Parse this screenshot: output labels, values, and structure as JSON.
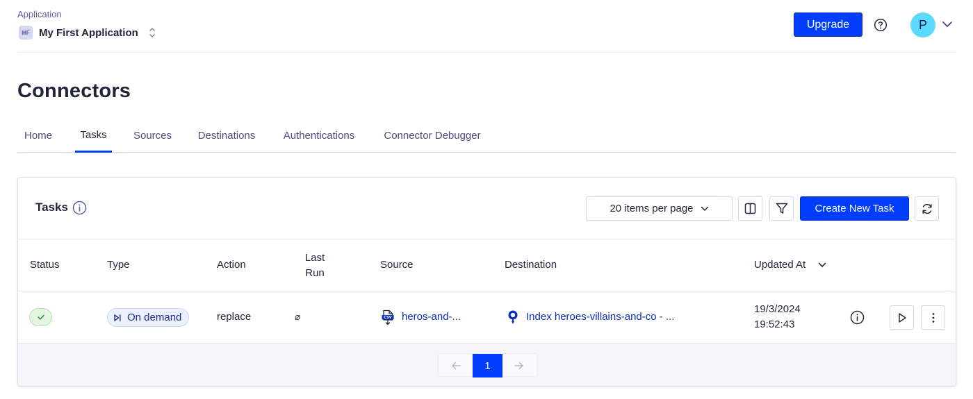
{
  "app": {
    "label": "Application",
    "avatar_initials": "MF",
    "name": "My First Application"
  },
  "header": {
    "upgrade_label": "Upgrade",
    "user_initial": "P"
  },
  "page": {
    "title": "Connectors"
  },
  "tabs": [
    {
      "label": "Home",
      "active": false
    },
    {
      "label": "Tasks",
      "active": true
    },
    {
      "label": "Sources",
      "active": false
    },
    {
      "label": "Destinations",
      "active": false
    },
    {
      "label": "Authentications",
      "active": false
    },
    {
      "label": "Connector Debugger",
      "active": false
    }
  ],
  "panel": {
    "title": "Tasks",
    "per_page_label": "20 items per page",
    "create_label": "Create New Task"
  },
  "table": {
    "columns": {
      "status": "Status",
      "type": "Type",
      "action": "Action",
      "last_run_1": "Last",
      "last_run_2": "Run",
      "source": "Source",
      "destination": "Destination",
      "updated_at": "Updated At"
    },
    "rows": [
      {
        "status": "success",
        "type": "On demand",
        "action": "replace",
        "last_run": "⌀",
        "source": "heros-and-...",
        "destination": "Index heroes-villains-and-co - ...",
        "updated_date": "19/3/2024",
        "updated_time": "19:52:43"
      }
    ]
  },
  "pagination": {
    "current_page": "1"
  },
  "colors": {
    "primary": "#003dff",
    "text": "#23263b",
    "success_bg": "#e3f6e2",
    "success_fg": "#2e8b2a"
  },
  "icons": {
    "help": "help-circle-icon",
    "user_menu": "chevron-down-icon",
    "columns": "columns-icon",
    "filter": "filter-icon",
    "refresh": "refresh-icon",
    "info": "info-icon",
    "play": "play-icon",
    "more": "more-vertical-icon"
  }
}
